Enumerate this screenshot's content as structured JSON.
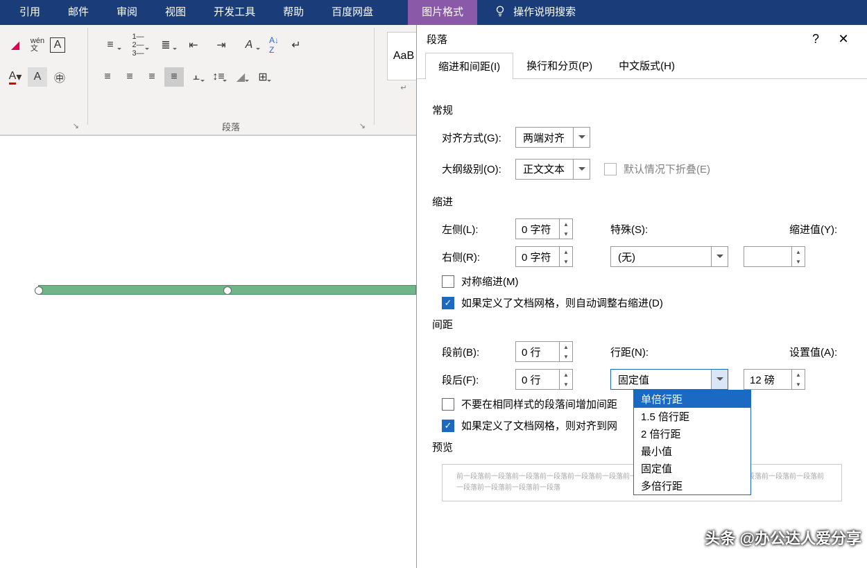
{
  "ribbon": {
    "tabs": [
      "引用",
      "邮件",
      "审阅",
      "视图",
      "开发工具",
      "帮助",
      "百度网盘"
    ],
    "context_tab": "图片格式",
    "tell_me": "操作说明搜索",
    "paragraph_group": "段落",
    "style_preview": "AaB"
  },
  "dialog": {
    "title": "段落",
    "tabs": {
      "indent": "缩进和间距(I)",
      "breaks": "换行和分页(P)",
      "asian": "中文版式(H)"
    },
    "general": {
      "title": "常规",
      "alignment_label": "对齐方式(G):",
      "alignment_value": "两端对齐",
      "outline_label": "大纲级别(O):",
      "outline_value": "正文文本",
      "collapse_label": "默认情况下折叠(E)"
    },
    "indent": {
      "title": "缩进",
      "left_label": "左侧(L):",
      "left_value": "0 字符",
      "right_label": "右侧(R):",
      "right_value": "0 字符",
      "special_label": "特殊(S):",
      "special_value": "(无)",
      "by_label": "缩进值(Y):",
      "mirror_label": "对称缩进(M)",
      "grid_label": "如果定义了文档网格，则自动调整右缩进(D)"
    },
    "spacing": {
      "title": "间距",
      "before_label": "段前(B):",
      "before_value": "0 行",
      "after_label": "段后(F):",
      "after_value": "0 行",
      "line_label": "行距(N):",
      "line_value": "固定值",
      "at_label": "设置值(A):",
      "at_value": "12 磅",
      "nospace_label": "不要在相同样式的段落间增加间距",
      "grid_label": "如果定义了文档网格，则对齐到网"
    },
    "line_options": [
      "单倍行距",
      "1.5 倍行距",
      "2 倍行距",
      "最小值",
      "固定值",
      "多倍行距"
    ],
    "preview": {
      "title": "预览",
      "text": "前一段落前一段落前一段落前一段落前一段落前一段落前一段落前一段落前一段落前一段落前一段落前一段落前一段落前一段落前一段落前一段落前一段落"
    }
  },
  "watermark": "头条 @办公达人爱分享"
}
